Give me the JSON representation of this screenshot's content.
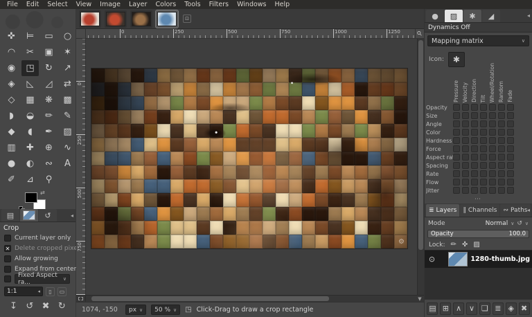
{
  "menu": {
    "items": [
      "File",
      "Edit",
      "Select",
      "View",
      "Image",
      "Layer",
      "Colors",
      "Tools",
      "Filters",
      "Windows",
      "Help"
    ]
  },
  "image_tabs": {
    "menu_button_glyph": "⊡",
    "tabs": [
      {
        "name": "image-tab-1",
        "c1": "#b8402e",
        "c2": "#e6e0d6"
      },
      {
        "name": "image-tab-2",
        "c1": "#c24a30",
        "c2": "#3a322c"
      },
      {
        "name": "image-tab-3",
        "c1": "#9a7048",
        "c2": "#241e1a"
      },
      {
        "name": "image-tab-4",
        "c1": "#5e88b0",
        "c2": "#dce6ee",
        "active": true
      }
    ]
  },
  "toolbox": {
    "fg_color": "#000000",
    "bg_color": "#ffffff",
    "tools": [
      {
        "name": "move-tool",
        "glyph": "✜"
      },
      {
        "name": "alignment-tool",
        "glyph": "⊨"
      },
      {
        "name": "rectangle-select-tool",
        "glyph": "▭"
      },
      {
        "name": "ellipse-select-tool",
        "glyph": "○"
      },
      {
        "name": "free-select-tool",
        "glyph": "◠"
      },
      {
        "name": "scissors-select-tool",
        "glyph": "✂"
      },
      {
        "name": "foreground-select-tool",
        "glyph": "▣"
      },
      {
        "name": "fuzzy-select-tool",
        "glyph": "✶"
      },
      {
        "name": "select-by-color-tool",
        "glyph": "◉"
      },
      {
        "name": "crop-tool",
        "glyph": "◳",
        "active": true
      },
      {
        "name": "rotate-tool",
        "glyph": "↻"
      },
      {
        "name": "unified-transform-tool",
        "glyph": "↗"
      },
      {
        "name": "handle-transform-tool",
        "glyph": "◈"
      },
      {
        "name": "perspective-tool",
        "glyph": "◺"
      },
      {
        "name": "shear-tool",
        "glyph": "◿"
      },
      {
        "name": "flip-tool",
        "glyph": "⇄"
      },
      {
        "name": "3d-transform-tool",
        "glyph": "◇"
      },
      {
        "name": "warp-transform-tool",
        "glyph": "▦"
      },
      {
        "name": "n-point-deformation-tool",
        "glyph": "❋"
      },
      {
        "name": "cage-transform-tool",
        "glyph": "▩"
      },
      {
        "name": "gradient-tool",
        "glyph": "◗"
      },
      {
        "name": "bucket-fill-tool",
        "glyph": "◒"
      },
      {
        "name": "pencil-tool",
        "glyph": "✏"
      },
      {
        "name": "paintbrush-tool",
        "glyph": "✎"
      },
      {
        "name": "eraser-tool",
        "glyph": "◆"
      },
      {
        "name": "airbrush-tool",
        "glyph": "◖"
      },
      {
        "name": "ink-tool",
        "glyph": "✒"
      },
      {
        "name": "mypaint-brush-tool",
        "glyph": "▨"
      },
      {
        "name": "clone-tool",
        "glyph": "▥"
      },
      {
        "name": "heal-tool",
        "glyph": "✚"
      },
      {
        "name": "perspective-clone-tool",
        "glyph": "⊕"
      },
      {
        "name": "smudge-tool",
        "glyph": "∿"
      },
      {
        "name": "blur-sharpen-tool",
        "glyph": "●"
      },
      {
        "name": "dodge-burn-tool",
        "glyph": "◐"
      },
      {
        "name": "paths-tool",
        "glyph": "∾"
      },
      {
        "name": "text-tool",
        "glyph": "A"
      },
      {
        "name": "color-picker-tool",
        "glyph": "✐"
      },
      {
        "name": "measure-tool",
        "glyph": "⊿"
      },
      {
        "name": "zoom-tool",
        "glyph": "⚲"
      }
    ]
  },
  "tool_options": {
    "collapse_glyph": "◂",
    "dock_tabs": [
      {
        "name": "tool-options-tab",
        "glyph": "▤"
      },
      {
        "name": "device-status-tab",
        "thumb": true,
        "active": true
      },
      {
        "name": "undo-history-tab",
        "glyph": "↺"
      }
    ],
    "title": "Crop",
    "checkboxes": [
      {
        "label": "Current layer only",
        "checked": false
      },
      {
        "label": "Delete cropped pixels",
        "checked": true
      },
      {
        "label": "Allow growing",
        "checked": false
      },
      {
        "label": "Expand from center",
        "checked": false
      }
    ],
    "fixed": {
      "checked": false,
      "dropdown": "Fixed Aspect ra...",
      "value": "1:1",
      "clear_glyph": "◂"
    },
    "buttons": [
      {
        "name": "save-preset-button",
        "glyph": "↧"
      },
      {
        "name": "restore-preset-button",
        "glyph": "↺"
      },
      {
        "name": "delete-preset-button",
        "glyph": "✖"
      },
      {
        "name": "reset-tool-button",
        "glyph": "↻"
      }
    ]
  },
  "canvas": {
    "h_ruler_labels": [
      {
        "text": "0",
        "pos": 49
      },
      {
        "text": "250",
        "pos": 126
      },
      {
        "text": "500",
        "pos": 203
      },
      {
        "text": "750",
        "pos": 280
      },
      {
        "text": "1000",
        "pos": 357
      },
      {
        "text": "1250",
        "pos": 434
      }
    ],
    "v_ruler_labels": [
      {
        "text": "0",
        "pos": 61
      },
      {
        "text": "250",
        "pos": 138
      },
      {
        "text": "500",
        "pos": 215
      },
      {
        "text": "750",
        "pos": 292
      }
    ],
    "statusbar": {
      "position": "1074, -150",
      "unit": "px",
      "zoom": "50 %",
      "message": "Click-Drag to draw a crop rectangle"
    },
    "watermark_glyph": "⚙",
    "mosaic": {
      "cols": 24,
      "rows": 13,
      "palette": [
        "#5b3a22",
        "#7a4a28",
        "#96603a",
        "#b07a45",
        "#c89a62",
        "#dfc089",
        "#eedcb4",
        "#3c2414",
        "#2a180d",
        "#8a4a22",
        "#c06a2e",
        "#de9340",
        "#6e5538",
        "#4a3322",
        "#9c7a50",
        "#d8a968",
        "#84561f",
        "#b98856",
        "#7b8a4a",
        "#46607a",
        "#caa87c",
        "#a06a3c"
      ]
    }
  },
  "right_panel": {
    "collapse_glyph": "◂",
    "dock_tabs": [
      {
        "name": "brushes-tab",
        "glyph": "●"
      },
      {
        "name": "patterns-tab",
        "glyph": "▨",
        "light": true
      },
      {
        "name": "dynamics-tab",
        "glyph": "✱",
        "active": true
      },
      {
        "name": "gradients-tab",
        "glyph": "◢"
      }
    ],
    "dynamics_header": "Dynamics Off",
    "mapping_dropdown": "Mapping matrix",
    "icon_label": "Icon:",
    "icon_button_glyph": "✱",
    "matrix": {
      "columns": [
        "Pressure",
        "Velocity",
        "Direction",
        "Tilt",
        "Wheel/Rotation",
        "Random",
        "Fade"
      ],
      "rows": [
        "Opacity",
        "Size",
        "Angle",
        "Color",
        "Hardness",
        "Force",
        "Aspect ratio",
        "Spacing",
        "Rate",
        "Flow",
        "Jitter"
      ]
    },
    "splitter_glyph": "⋯",
    "layers": {
      "tabs": [
        {
          "name": "layers-tab",
          "label": "Layers",
          "glyph": "≣",
          "active": true
        },
        {
          "name": "channels-tab",
          "label": "Channels",
          "glyph": "∥"
        },
        {
          "name": "paths-tab",
          "label": "Paths",
          "glyph": "∾"
        }
      ],
      "mode_label": "Mode",
      "mode_value": "Normal",
      "mode_reset_glyph": "↺",
      "opacity_label": "Opacity",
      "opacity_value": "100.0",
      "lock_label": "Lock:",
      "lock_icons": [
        {
          "name": "lock-pixels-icon",
          "glyph": "✏"
        },
        {
          "name": "lock-position-icon",
          "glyph": "✜"
        },
        {
          "name": "lock-alpha-icon",
          "glyph": "▨"
        }
      ],
      "layer": {
        "name_text": "1280-thumb.jpg",
        "eye_glyph": "⊙"
      },
      "buttons": [
        {
          "name": "new-layer-button",
          "glyph": "▤"
        },
        {
          "name": "new-layer-group-button",
          "glyph": "⊞"
        },
        {
          "name": "raise-layer-button",
          "glyph": "∧"
        },
        {
          "name": "lower-layer-button",
          "glyph": "∨"
        },
        {
          "name": "duplicate-layer-button",
          "glyph": "❏"
        },
        {
          "name": "merge-down-button",
          "glyph": "≣"
        },
        {
          "name": "add-mask-button",
          "glyph": "◈"
        },
        {
          "name": "delete-layer-button",
          "glyph": "✖"
        }
      ]
    }
  }
}
